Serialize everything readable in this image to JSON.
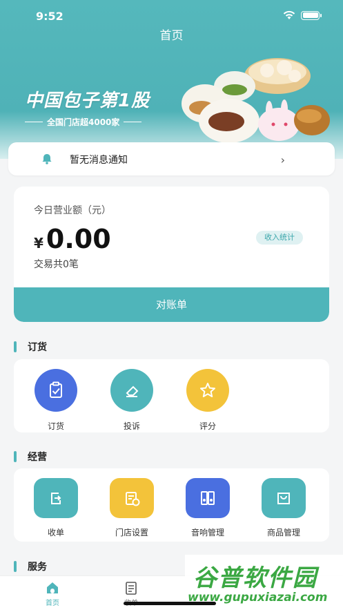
{
  "status": {
    "time": "9:52"
  },
  "header": {
    "title": "首页"
  },
  "banner": {
    "headline": "中国包子第1股",
    "subline": "全国门店超4000家"
  },
  "notice": {
    "text": "暂无消息通知"
  },
  "revenue": {
    "label": "今日营业额（元）",
    "currency": "¥",
    "amount": "0.00",
    "count_text": "交易共0笔",
    "stats_button": "收入统计",
    "reconcile_button": "对账单"
  },
  "sections": {
    "ordering": {
      "title": "订货",
      "items": [
        {
          "label": "订货",
          "icon": "clipboard-check-icon",
          "color": "#4a6fe0"
        },
        {
          "label": "投诉",
          "icon": "eraser-icon",
          "color": "#4fb5ba"
        },
        {
          "label": "评分",
          "icon": "star-icon",
          "color": "#f3c33a"
        }
      ]
    },
    "operations": {
      "title": "经营",
      "items": [
        {
          "label": "收单",
          "icon": "checkout-icon",
          "color": "#4fb5ba"
        },
        {
          "label": "门店设置",
          "icon": "store-settings-icon",
          "color": "#f3c33a"
        },
        {
          "label": "音响管理",
          "icon": "speaker-icon",
          "color": "#4a6fe0"
        },
        {
          "label": "商品管理",
          "icon": "shopping-bag-icon",
          "color": "#4fb5ba"
        }
      ]
    },
    "services": {
      "title": "服务"
    }
  },
  "tabbar": {
    "items": [
      {
        "label": "首页",
        "icon": "home-icon",
        "active": true
      },
      {
        "label": "收单",
        "icon": "document-icon",
        "active": false
      }
    ]
  },
  "watermark": {
    "main": "谷普软件园",
    "url": "www.gupuxiazai.com"
  },
  "colors": {
    "accent": "#4fb5ba",
    "blue": "#4a6fe0",
    "yellow": "#f3c33a"
  }
}
